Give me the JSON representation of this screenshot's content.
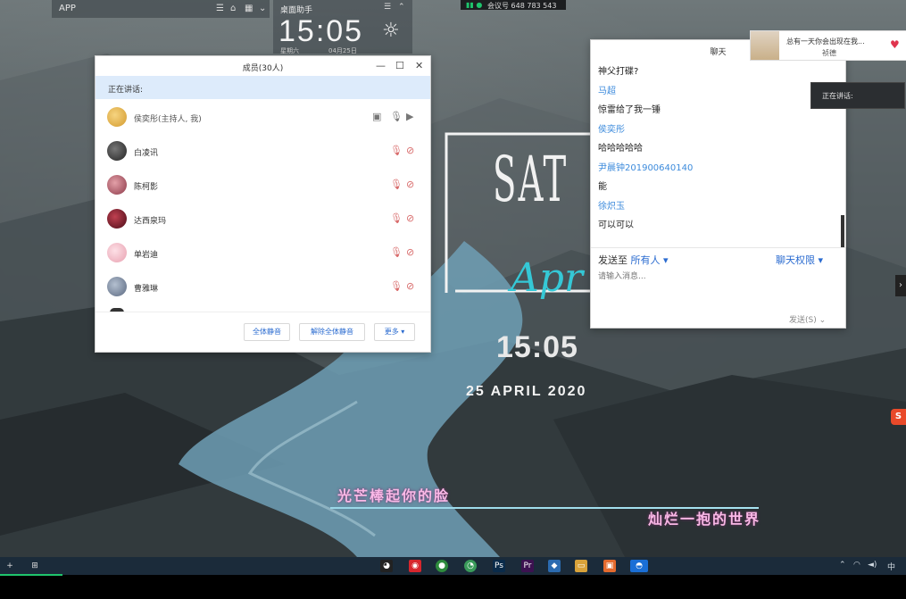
{
  "top": {
    "app_label": "APP",
    "clock_widget_title": "桌面助手",
    "clock_time": "15:05",
    "clock_weekday": "星期六",
    "clock_date": "04月25日",
    "meeting_id": "会议号 648 783 543"
  },
  "wallpaper": {
    "logo_main": "SAT",
    "logo_script": "Apr",
    "time": "15:05",
    "date": "25 APRIL 2020",
    "lyric_line1": "光芒棒起你的脸",
    "lyric_line2": "灿烂一抱的世界"
  },
  "members_window": {
    "title": "成员(30人)",
    "speaking_label": "正在讲话:",
    "members": [
      {
        "name": "侯奕彤(主持人, 我)",
        "avatar_color": "#e0b24a",
        "muted": false,
        "video_off": false
      },
      {
        "name": "白凌讯",
        "avatar_color": "#3b3b3b",
        "muted": true,
        "video_off": true
      },
      {
        "name": "陈柯影",
        "avatar_color": "#b05a6a",
        "muted": true,
        "video_off": true
      },
      {
        "name": "达西泉玛",
        "avatar_color": "#8a2230",
        "muted": true,
        "video_off": true
      },
      {
        "name": "单岩迪",
        "avatar_color": "#f0b8c0",
        "muted": true,
        "video_off": true
      },
      {
        "name": "曹雅琳",
        "avatar_color": "#7a8aa0",
        "muted": true,
        "video_off": true
      }
    ],
    "buttons": {
      "mute_all": "全体静音",
      "unmute_all": "解除全体静音",
      "more": "更多 ▾"
    }
  },
  "chat_window": {
    "title": "聊天",
    "messages": [
      {
        "kind": "body",
        "text": "神父打碟?"
      },
      {
        "kind": "name",
        "text": "马超"
      },
      {
        "kind": "body",
        "text": "惊雷给了我一锤"
      },
      {
        "kind": "name",
        "text": "侯奕彤"
      },
      {
        "kind": "body",
        "text": "哈哈哈哈哈"
      },
      {
        "kind": "name",
        "text": "尹晨钟201900640140"
      },
      {
        "kind": "body",
        "text": "能"
      },
      {
        "kind": "name",
        "text": "徐炽玉"
      },
      {
        "kind": "body",
        "text": "可以可以"
      }
    ],
    "send_to_label": "发送至",
    "send_to_target": "所有人 ▾",
    "permission_label": "聊天权限 ▾",
    "input_placeholder": "请输入消息...",
    "send_button": "发送(S)  ⌄"
  },
  "notification": {
    "line1": "总有一天你会出现在我...",
    "line2": "祯德"
  },
  "speaking_tip": "正在讲话:",
  "colors": {
    "accent_blue": "#2a6bd0",
    "name_blue": "#3d8bdc",
    "speaking_bg": "#ddebfb",
    "taskbar": "#1b2b3a",
    "lyric_pink": "#f9b8e6"
  }
}
